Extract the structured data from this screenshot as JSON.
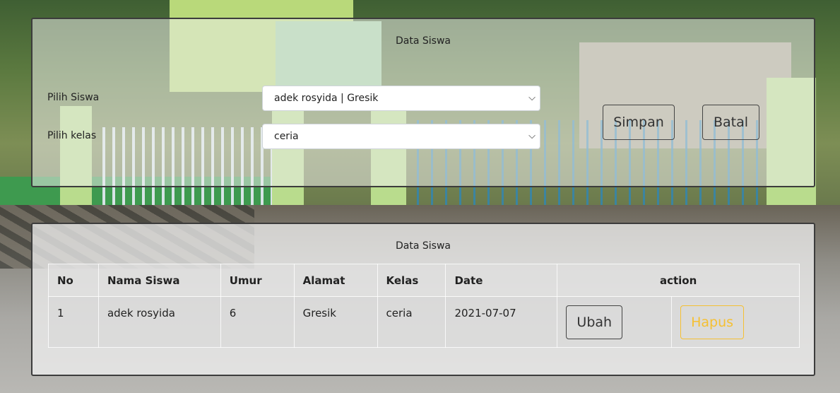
{
  "form": {
    "title": "Data Siswa",
    "siswa_label": "Pilih Siswa",
    "siswa_value": "adek rosyida | Gresik",
    "kelas_label": "Pilih kelas",
    "kelas_value": "ceria",
    "save_label": "Simpan",
    "cancel_label": "Batal"
  },
  "table": {
    "title": "Data Siswa",
    "headers": [
      "No",
      "Nama Siswa",
      "Umur",
      "Alamat",
      "Kelas",
      "Date",
      "action"
    ],
    "rows": [
      {
        "no": "1",
        "nama": "adek rosyida",
        "umur": "6",
        "alamat": "Gresik",
        "kelas": "ceria",
        "date": "2021-07-07",
        "edit_label": "Ubah",
        "delete_label": "Hapus"
      }
    ]
  },
  "colors": {
    "delete_accent": "#f5c033",
    "border": "#3c3c3c"
  }
}
